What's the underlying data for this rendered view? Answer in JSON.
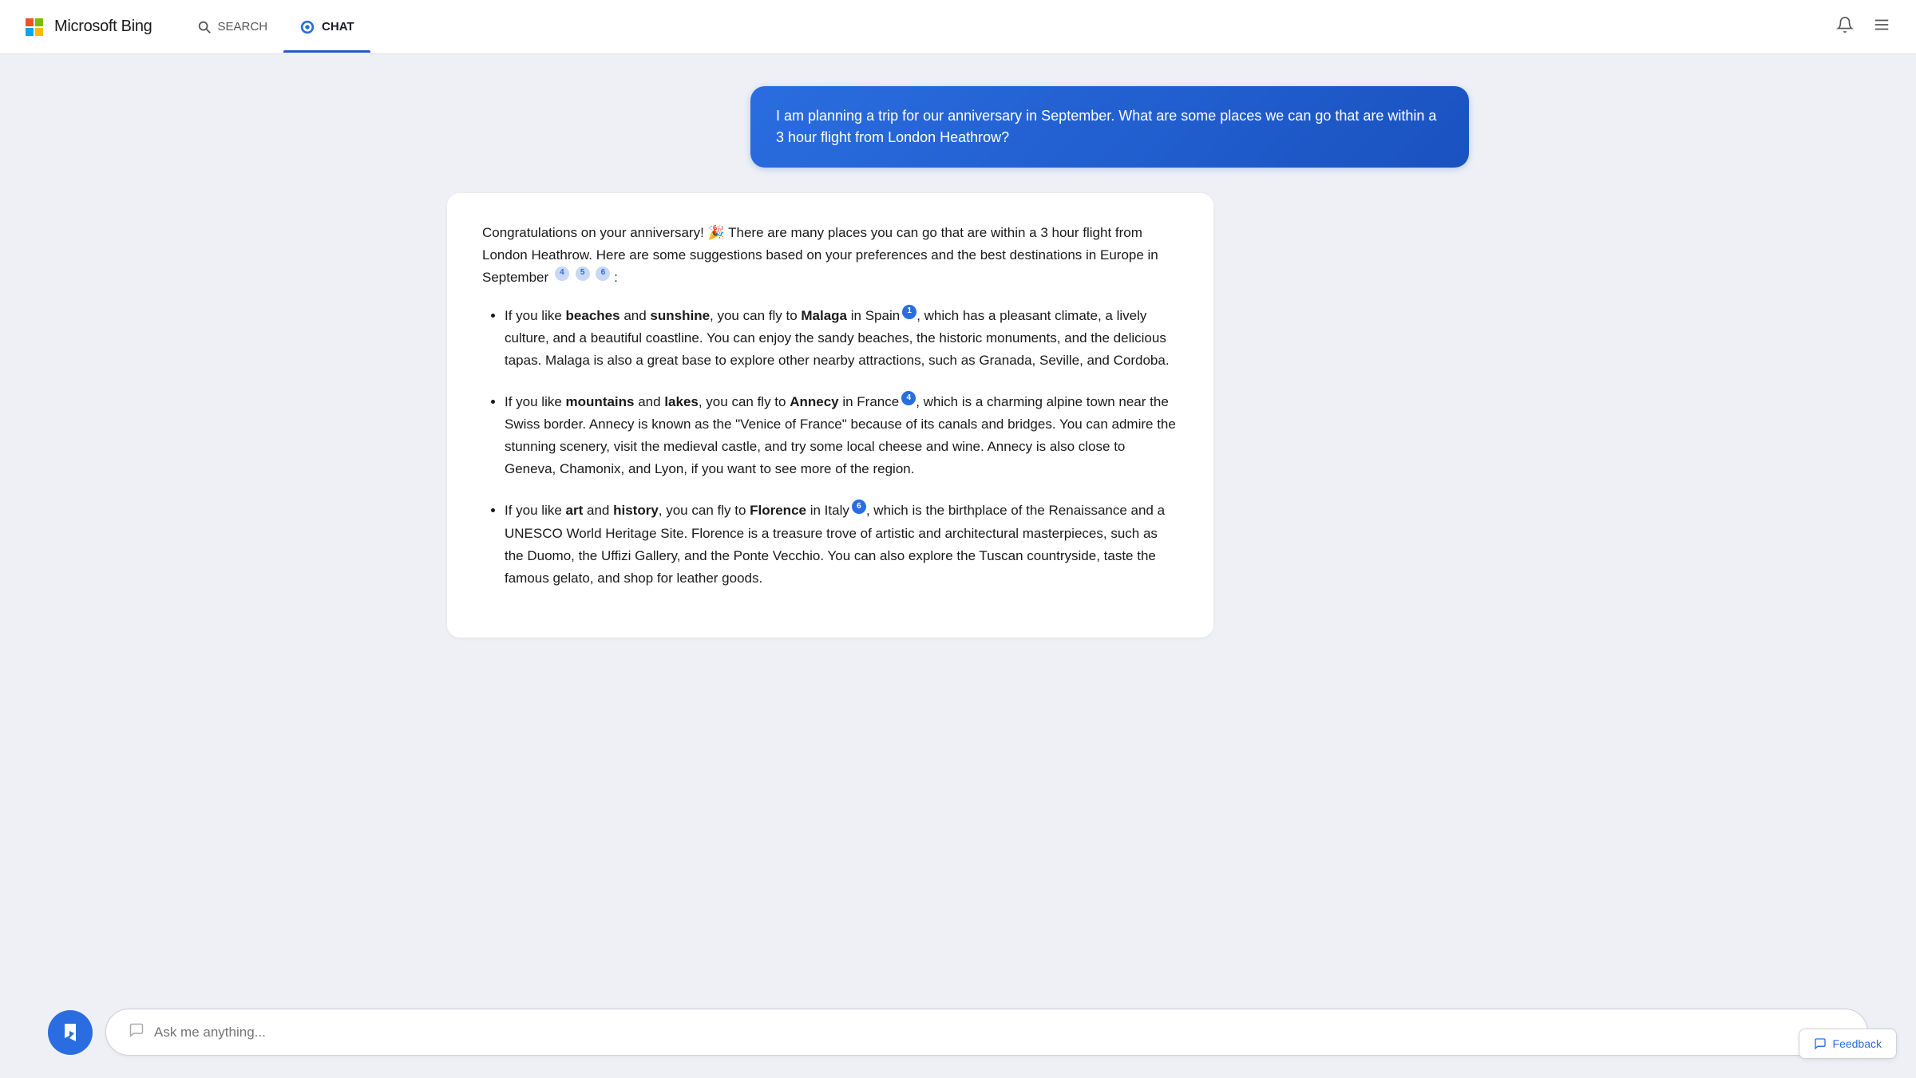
{
  "header": {
    "logo_text": "Microsoft Bing",
    "nav": [
      {
        "id": "search",
        "label": "SEARCH",
        "active": false
      },
      {
        "id": "chat",
        "label": "CHAT",
        "active": true
      }
    ],
    "icons": {
      "bell": "🔔",
      "menu": "☰"
    }
  },
  "user_message": {
    "text": "I am planning a trip for our anniversary in September. What are some places we can go that are within a 3 hour flight from London Heathrow?"
  },
  "ai_response": {
    "intro": "Congratulations on your anniversary! 🎉 There are many places you can go that are within a 3 hour flight from London Heathrow. Here are some suggestions based on your preferences and the best destinations in Europe in September",
    "intro_citations": [
      "4",
      "5",
      "6"
    ],
    "items": [
      {
        "text_before": "If you like ",
        "bold1": "beaches",
        "text_mid1": " and ",
        "bold2": "sunshine",
        "text_mid2": ", you can fly to ",
        "bold3": "Malaga",
        "text_mid3": " in Spain",
        "citation": "1",
        "text_rest": ", which has a pleasant climate, a lively culture, and a beautiful coastline. You can enjoy the sandy beaches, the historic monuments, and the delicious tapas. Malaga is also a great base to explore other nearby attractions, such as Granada, Seville, and Cordoba."
      },
      {
        "text_before": "If you like ",
        "bold1": "mountains",
        "text_mid1": " and ",
        "bold2": "lakes",
        "text_mid2": ", you can fly to ",
        "bold3": "Annecy",
        "text_mid3": " in France",
        "citation": "4",
        "text_rest": ", which is a charming alpine town near the Swiss border. Annecy is known as the \"Venice of France\" because of its canals and bridges. You can admire the stunning scenery, visit the medieval castle, and try some local cheese and wine. Annecy is also close to Geneva, Chamonix, and Lyon, if you want to see more of the region."
      },
      {
        "text_before": "If you like ",
        "bold1": "art",
        "text_mid1": " and ",
        "bold2": "history",
        "text_mid2": ", you can fly to ",
        "bold3": "Florence",
        "text_mid3": " in Italy",
        "citation": "6",
        "text_rest": ", which is the birthplace of the Renaissance and a UNESCO World Heritage Site. Florence is a treasure trove of artistic and architectural masterpieces, such as the Duomo, the Uffizi Gallery, and the Ponte Vecchio. You can also explore the Tuscan countryside, taste the famous gelato, and shop for leather goods."
      }
    ]
  },
  "input": {
    "placeholder": "Ask me anything..."
  },
  "feedback": {
    "label": "Feedback"
  }
}
